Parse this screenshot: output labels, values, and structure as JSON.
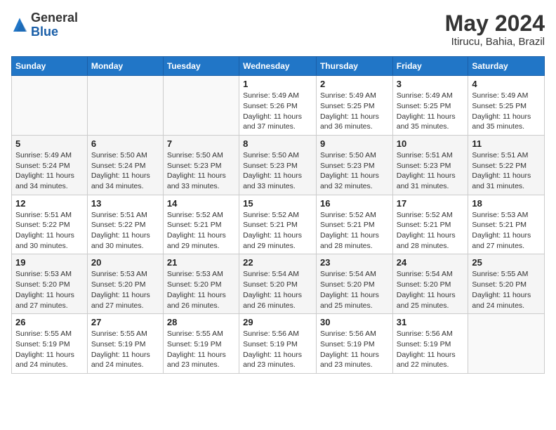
{
  "logo": {
    "general": "General",
    "blue": "Blue"
  },
  "calendar": {
    "title": "May 2024",
    "subtitle": "Itirucu, Bahia, Brazil"
  },
  "weekdays": [
    "Sunday",
    "Monday",
    "Tuesday",
    "Wednesday",
    "Thursday",
    "Friday",
    "Saturday"
  ],
  "weeks": [
    [
      {
        "day": "",
        "info": ""
      },
      {
        "day": "",
        "info": ""
      },
      {
        "day": "",
        "info": ""
      },
      {
        "day": "1",
        "info": "Sunrise: 5:49 AM\nSunset: 5:26 PM\nDaylight: 11 hours and 37 minutes."
      },
      {
        "day": "2",
        "info": "Sunrise: 5:49 AM\nSunset: 5:25 PM\nDaylight: 11 hours and 36 minutes."
      },
      {
        "day": "3",
        "info": "Sunrise: 5:49 AM\nSunset: 5:25 PM\nDaylight: 11 hours and 35 minutes."
      },
      {
        "day": "4",
        "info": "Sunrise: 5:49 AM\nSunset: 5:25 PM\nDaylight: 11 hours and 35 minutes."
      }
    ],
    [
      {
        "day": "5",
        "info": "Sunrise: 5:49 AM\nSunset: 5:24 PM\nDaylight: 11 hours and 34 minutes."
      },
      {
        "day": "6",
        "info": "Sunrise: 5:50 AM\nSunset: 5:24 PM\nDaylight: 11 hours and 34 minutes."
      },
      {
        "day": "7",
        "info": "Sunrise: 5:50 AM\nSunset: 5:23 PM\nDaylight: 11 hours and 33 minutes."
      },
      {
        "day": "8",
        "info": "Sunrise: 5:50 AM\nSunset: 5:23 PM\nDaylight: 11 hours and 33 minutes."
      },
      {
        "day": "9",
        "info": "Sunrise: 5:50 AM\nSunset: 5:23 PM\nDaylight: 11 hours and 32 minutes."
      },
      {
        "day": "10",
        "info": "Sunrise: 5:51 AM\nSunset: 5:23 PM\nDaylight: 11 hours and 31 minutes."
      },
      {
        "day": "11",
        "info": "Sunrise: 5:51 AM\nSunset: 5:22 PM\nDaylight: 11 hours and 31 minutes."
      }
    ],
    [
      {
        "day": "12",
        "info": "Sunrise: 5:51 AM\nSunset: 5:22 PM\nDaylight: 11 hours and 30 minutes."
      },
      {
        "day": "13",
        "info": "Sunrise: 5:51 AM\nSunset: 5:22 PM\nDaylight: 11 hours and 30 minutes."
      },
      {
        "day": "14",
        "info": "Sunrise: 5:52 AM\nSunset: 5:21 PM\nDaylight: 11 hours and 29 minutes."
      },
      {
        "day": "15",
        "info": "Sunrise: 5:52 AM\nSunset: 5:21 PM\nDaylight: 11 hours and 29 minutes."
      },
      {
        "day": "16",
        "info": "Sunrise: 5:52 AM\nSunset: 5:21 PM\nDaylight: 11 hours and 28 minutes."
      },
      {
        "day": "17",
        "info": "Sunrise: 5:52 AM\nSunset: 5:21 PM\nDaylight: 11 hours and 28 minutes."
      },
      {
        "day": "18",
        "info": "Sunrise: 5:53 AM\nSunset: 5:21 PM\nDaylight: 11 hours and 27 minutes."
      }
    ],
    [
      {
        "day": "19",
        "info": "Sunrise: 5:53 AM\nSunset: 5:20 PM\nDaylight: 11 hours and 27 minutes."
      },
      {
        "day": "20",
        "info": "Sunrise: 5:53 AM\nSunset: 5:20 PM\nDaylight: 11 hours and 27 minutes."
      },
      {
        "day": "21",
        "info": "Sunrise: 5:53 AM\nSunset: 5:20 PM\nDaylight: 11 hours and 26 minutes."
      },
      {
        "day": "22",
        "info": "Sunrise: 5:54 AM\nSunset: 5:20 PM\nDaylight: 11 hours and 26 minutes."
      },
      {
        "day": "23",
        "info": "Sunrise: 5:54 AM\nSunset: 5:20 PM\nDaylight: 11 hours and 25 minutes."
      },
      {
        "day": "24",
        "info": "Sunrise: 5:54 AM\nSunset: 5:20 PM\nDaylight: 11 hours and 25 minutes."
      },
      {
        "day": "25",
        "info": "Sunrise: 5:55 AM\nSunset: 5:20 PM\nDaylight: 11 hours and 24 minutes."
      }
    ],
    [
      {
        "day": "26",
        "info": "Sunrise: 5:55 AM\nSunset: 5:19 PM\nDaylight: 11 hours and 24 minutes."
      },
      {
        "day": "27",
        "info": "Sunrise: 5:55 AM\nSunset: 5:19 PM\nDaylight: 11 hours and 24 minutes."
      },
      {
        "day": "28",
        "info": "Sunrise: 5:55 AM\nSunset: 5:19 PM\nDaylight: 11 hours and 23 minutes."
      },
      {
        "day": "29",
        "info": "Sunrise: 5:56 AM\nSunset: 5:19 PM\nDaylight: 11 hours and 23 minutes."
      },
      {
        "day": "30",
        "info": "Sunrise: 5:56 AM\nSunset: 5:19 PM\nDaylight: 11 hours and 23 minutes."
      },
      {
        "day": "31",
        "info": "Sunrise: 5:56 AM\nSunset: 5:19 PM\nDaylight: 11 hours and 22 minutes."
      },
      {
        "day": "",
        "info": ""
      }
    ]
  ]
}
